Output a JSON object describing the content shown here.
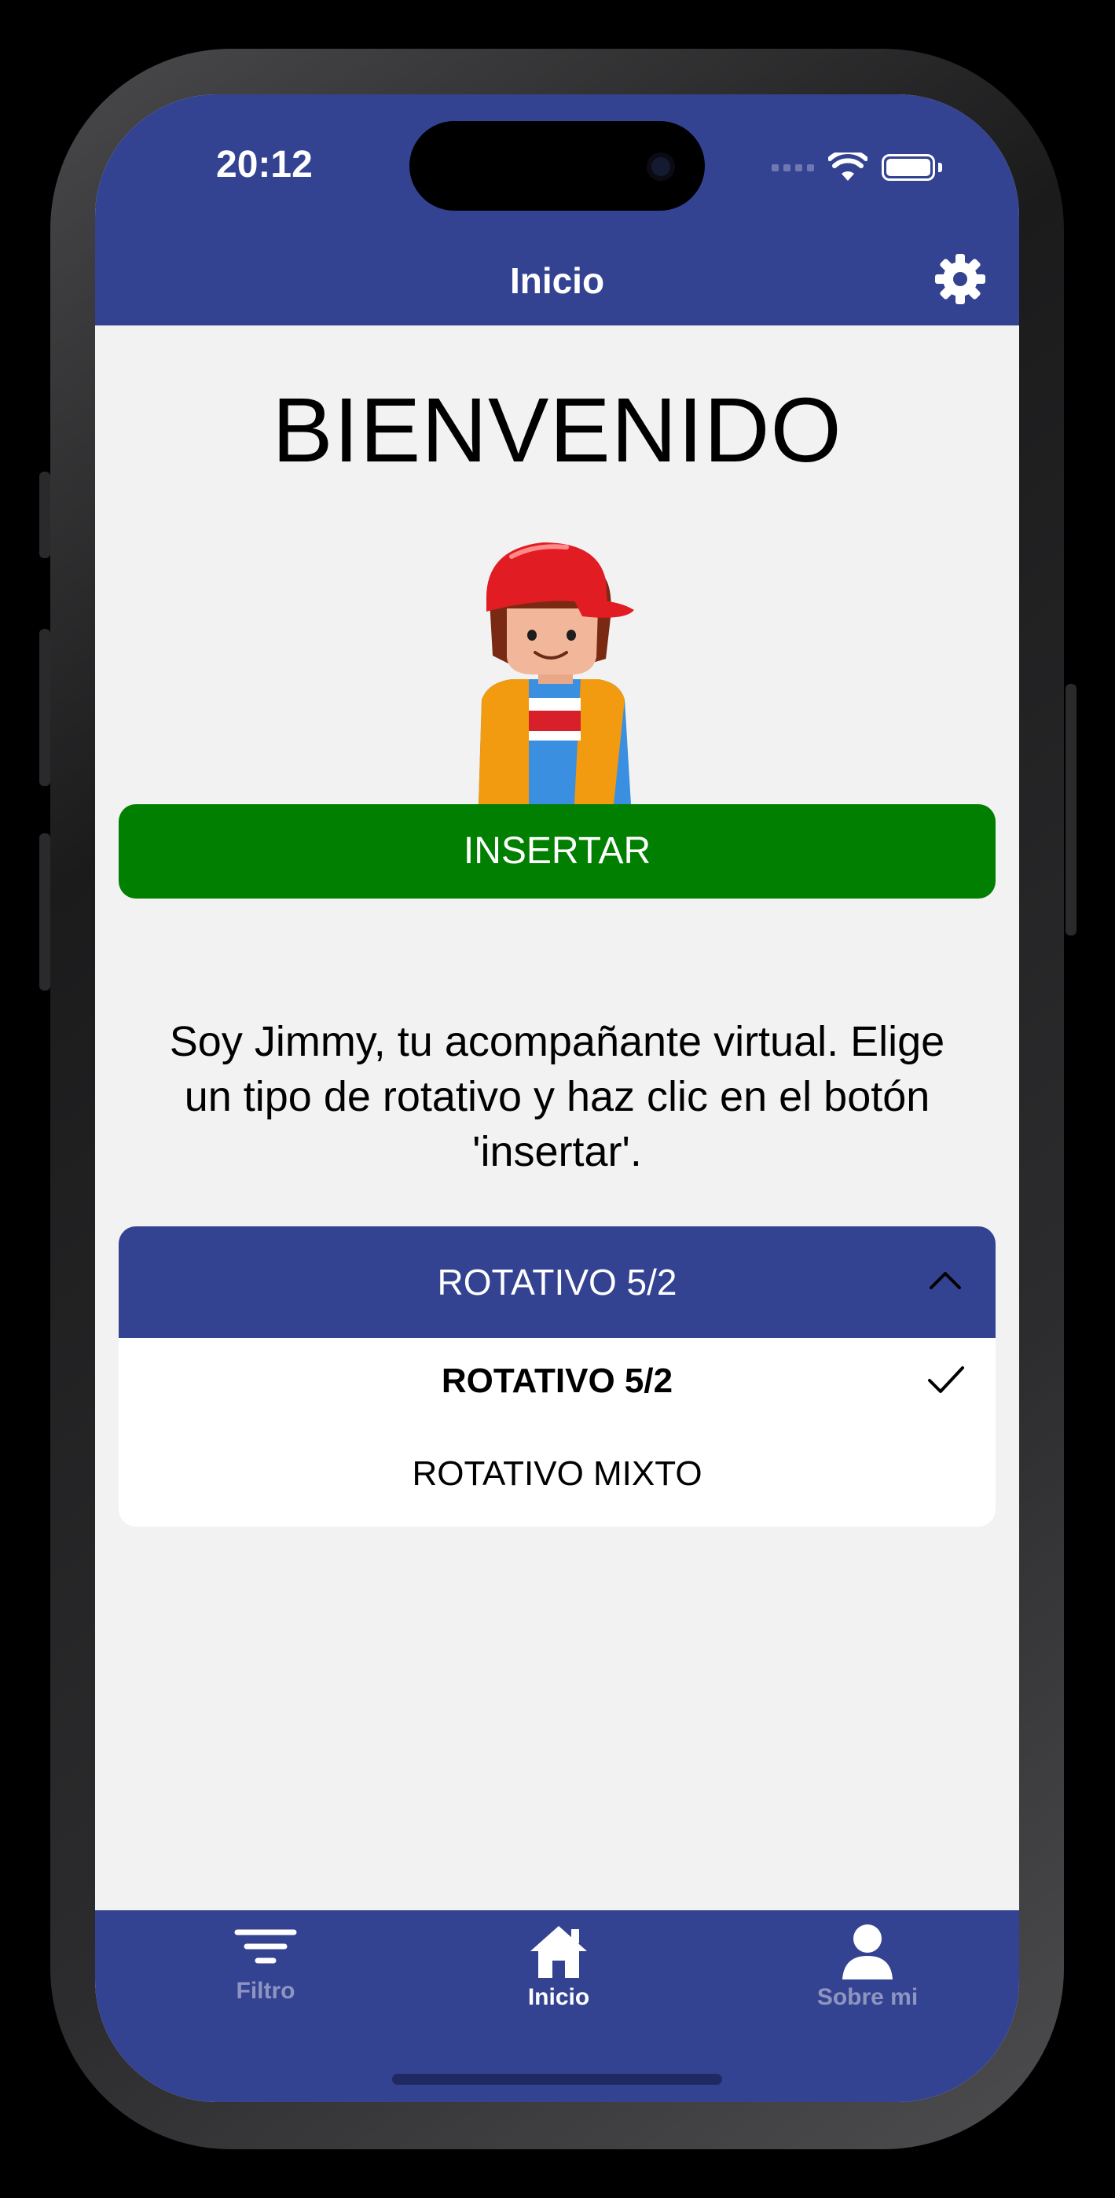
{
  "status_bar": {
    "time": "20:12"
  },
  "header": {
    "title": "Inicio"
  },
  "main": {
    "welcome": "BIENVENIDO",
    "insert_button": "INSERTAR",
    "intro_text": "Soy Jimmy, tu acompañante virtual. Elige un tipo de rotativo y haz clic en el botón 'insertar'."
  },
  "dropdown": {
    "selected": "ROTATIVO 5/2",
    "options": [
      "ROTATIVO 5/2",
      "ROTATIVO MIXTO"
    ],
    "expanded": true
  },
  "tabbar": {
    "items": [
      {
        "label": "Filtro",
        "icon": "filter-icon",
        "active": false
      },
      {
        "label": "Inicio",
        "icon": "home-icon",
        "active": true
      },
      {
        "label": "Sobre mi",
        "icon": "person-icon",
        "active": false
      }
    ]
  },
  "colors": {
    "primary": "#344391",
    "insert_button": "#007f00",
    "background": "#f2f2f2"
  }
}
